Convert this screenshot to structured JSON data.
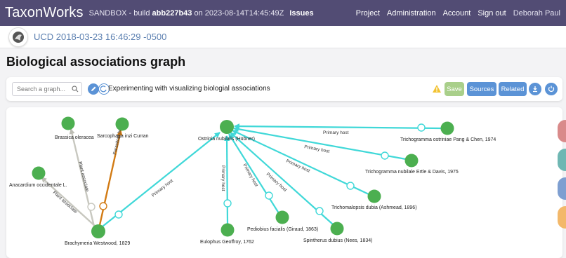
{
  "header": {
    "brand": "TaxonWorks",
    "build_prefix": "SANDBOX - build",
    "build_hash": "abb227b43",
    "build_suffix": "on 2023-08-14T14:45:49Z",
    "issues": "Issues",
    "nav": [
      "Project",
      "Administration",
      "Account",
      "Sign out"
    ],
    "user": "Deborah Paul"
  },
  "object_bar": {
    "title": "UCD 2018-03-23 16:46:29 -0500"
  },
  "page": {
    "title": "Biological associations graph"
  },
  "toolbar": {
    "search_placeholder": "Search a graph...",
    "graph_name": "Experimenting with visualizing biologial associations",
    "save_label": "Save",
    "sources_label": "Sources",
    "related_label": "Related",
    "colors": {
      "save": "#a9cf8a",
      "primary": "#5b93d6",
      "warning": "#f2c230"
    }
  },
  "graph": {
    "colors": {
      "node": "#4caf50",
      "primary_host": "#40d8d8",
      "parasitoid_host": "#d27b14",
      "plant_associate": "#c8c8c0"
    },
    "nodes": [
      {
        "id": "brassica",
        "label": "Brassica oleracea"
      },
      {
        "id": "sarcophaga",
        "label": "Sarcophaga inzi Curran"
      },
      {
        "id": "anacardium",
        "label": "Anacardium occidentale L."
      },
      {
        "id": "brachymeria",
        "label": "Brachymeria Westwood, 1829"
      },
      {
        "id": "ostrinia",
        "label": "Ostrinia nubilalis (Hübner)"
      },
      {
        "id": "tostriniae",
        "label": "Trichogramma ostriniae Pang & Chen, 1974"
      },
      {
        "id": "tnubilale",
        "label": "Trichogramma nubilale Ertle & Davis, 1975"
      },
      {
        "id": "trichomalopsis",
        "label": "Trichomalopsis dubia (Ashmead, 1896)"
      },
      {
        "id": "eulophus",
        "label": "Eulophus Geoffroy, 1762"
      },
      {
        "id": "pediobius",
        "label": "Pediobius facialis (Giraud, 1863)"
      },
      {
        "id": "spintherus",
        "label": "Spintherus dubius (Nees, 1834)"
      }
    ],
    "edge_labels": {
      "primary_host": "Primary host",
      "parasitoid_host": "Parasitoid host",
      "plant_associate": "Plant associate"
    }
  }
}
